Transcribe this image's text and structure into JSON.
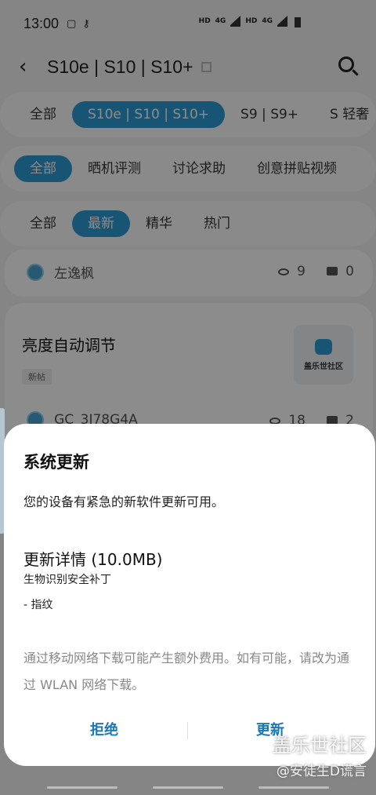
{
  "status": {
    "time": "13:00",
    "net1": "HD",
    "net2": "4G",
    "net3": "HD",
    "net4": "4G"
  },
  "header": {
    "title": "S10e | S10 | S10+"
  },
  "tabs_models": [
    "全部",
    "S10e | S10 | S10+",
    "S9 | S9+",
    "S 轻奢"
  ],
  "tabs_category": [
    "全部",
    "晒机评测",
    "讨论求助",
    "创意拼贴视频"
  ],
  "tabs_sort": [
    "全部",
    "最新",
    "精华",
    "热门"
  ],
  "posts": [
    {
      "author": "左逸枫",
      "views": "9",
      "comments": "0"
    },
    {
      "title": "亮度自动调节",
      "tag": "新帖",
      "thumb_label": "盖乐世社区",
      "author": "GC_3J78G4A",
      "views": "18",
      "comments": "2"
    }
  ],
  "dialog": {
    "title": "系统更新",
    "message": "您的设备有紧急的新软件更新可用。",
    "details_title": "更新详情 (10.0MB)",
    "detail_line1": "生物识别安全补丁",
    "detail_line2": "- 指纹",
    "warning": "通过移动网络下载可能产生额外费用。如有可能，请改为通过 WLAN 网络下载。",
    "reject_label": "拒绝",
    "update_label": "更新"
  },
  "watermark": {
    "line1": "盖乐世社区",
    "line2": "@安徒生D谎言"
  },
  "colors": {
    "accent": "#2d9bd4",
    "button": "#1a78b8"
  }
}
